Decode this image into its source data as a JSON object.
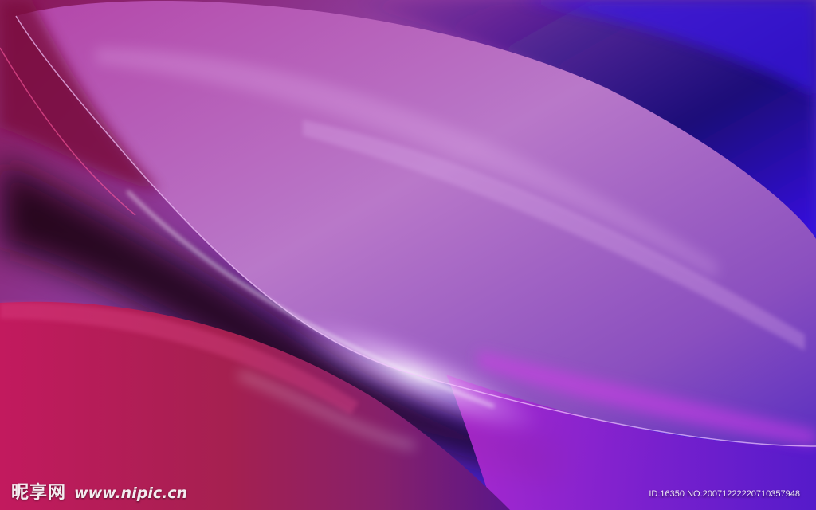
{
  "image": {
    "subject": "abstract-wave-wallpaper",
    "colors": {
      "magenta": "#c41b6a",
      "violet": "#9a45b8",
      "lavender": "#c07fd0",
      "blue": "#2a0ee0",
      "dark": "#140414",
      "highlight": "#ffffff"
    }
  },
  "watermark": {
    "brand": "昵享网",
    "site": "www.nipic.cn",
    "id_text": "ID:16350 NO:20071222220710357948"
  }
}
